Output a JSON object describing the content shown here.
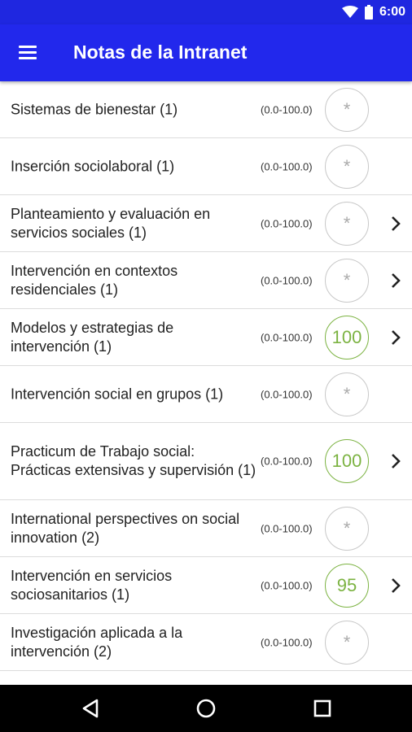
{
  "status": {
    "time": "6:00",
    "icons": [
      "wifi-icon",
      "battery-icon"
    ]
  },
  "appbar": {
    "title": "Notas de la Intranet",
    "menu_icon": "hamburger-menu-icon"
  },
  "colors": {
    "appbar": "#2228ec",
    "statusbar": "#1f27e0",
    "grade_pass": "#7cb342",
    "grade_empty": "#c8c8c8"
  },
  "courses": [
    {
      "name": "Sistemas de bienestar (1)",
      "range": "(0.0-100.0)",
      "grade": "*",
      "has_detail": false
    },
    {
      "name": "Inserción sociolaboral (1)",
      "range": "(0.0-100.0)",
      "grade": "*",
      "has_detail": false
    },
    {
      "name": "Planteamiento y evaluación en servicios sociales (1)",
      "range": "(0.0-100.0)",
      "grade": "*",
      "has_detail": true
    },
    {
      "name": "Intervención en contextos residenciales (1)",
      "range": "(0.0-100.0)",
      "grade": "*",
      "has_detail": true
    },
    {
      "name": "Modelos y estrategias de intervención (1)",
      "range": "(0.0-100.0)",
      "grade": "100",
      "has_detail": true
    },
    {
      "name": "Intervención social en grupos (1)",
      "range": "(0.0-100.0)",
      "grade": "*",
      "has_detail": false
    },
    {
      "name": "Practicum de Trabajo social: Prácticas extensivas y supervisión (1)",
      "range": "(0.0-100.0)",
      "grade": "100",
      "has_detail": true
    },
    {
      "name": "International perspectives on social innovation (2)",
      "range": "(0.0-100.0)",
      "grade": "*",
      "has_detail": false
    },
    {
      "name": "Intervención en servicios sociosanitarios (1)",
      "range": "(0.0-100.0)",
      "grade": "95",
      "has_detail": true
    },
    {
      "name": "Investigación aplicada a la intervención (2)",
      "range": "(0.0-100.0)",
      "grade": "*",
      "has_detail": false
    }
  ],
  "navbar": {
    "icons": [
      "back-icon",
      "home-icon",
      "recents-icon"
    ]
  }
}
